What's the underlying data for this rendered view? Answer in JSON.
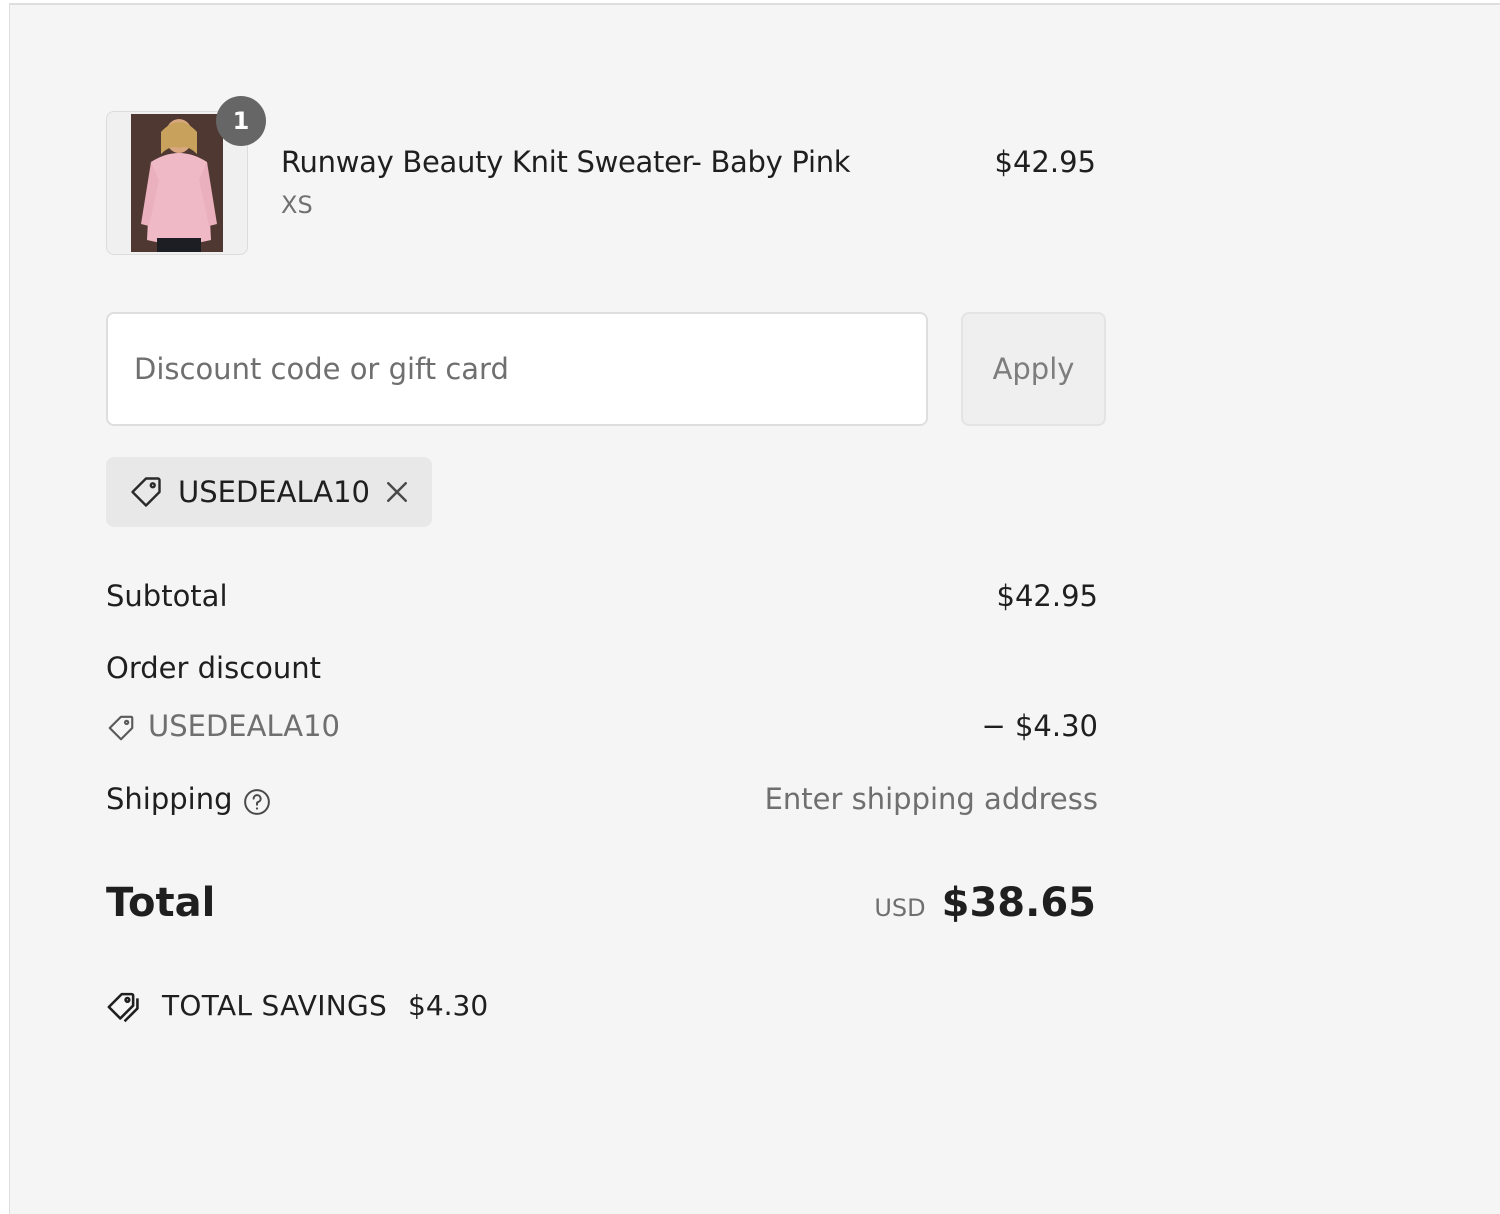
{
  "line_item": {
    "quantity": "1",
    "name": "Runway Beauty Knit Sweater- Baby Pink",
    "variant": "XS",
    "price": "$42.95"
  },
  "discount": {
    "placeholder": "Discount code or gift card",
    "value": "",
    "apply_label": "Apply",
    "applied_code": "USEDEALA10"
  },
  "summary": {
    "subtotal_label": "Subtotal",
    "subtotal_value": "$42.95",
    "order_discount_label": "Order discount",
    "discount_code": "USEDEALA10",
    "discount_value": "− $4.30",
    "shipping_label": "Shipping",
    "shipping_value": "Enter shipping address",
    "total_label": "Total",
    "currency": "USD",
    "total_value": "$38.65"
  },
  "savings": {
    "label": "TOTAL SAVINGS",
    "amount": "$4.30"
  },
  "icons": {
    "tag": "tag-icon",
    "close": "close-icon",
    "help": "help-circle-icon",
    "savings": "double-tag-icon"
  },
  "colors": {
    "panel_background": "#f5f5f5",
    "badge": "#666666",
    "muted_text": "#6f6f6f",
    "chip_background": "#e8e8e8"
  }
}
